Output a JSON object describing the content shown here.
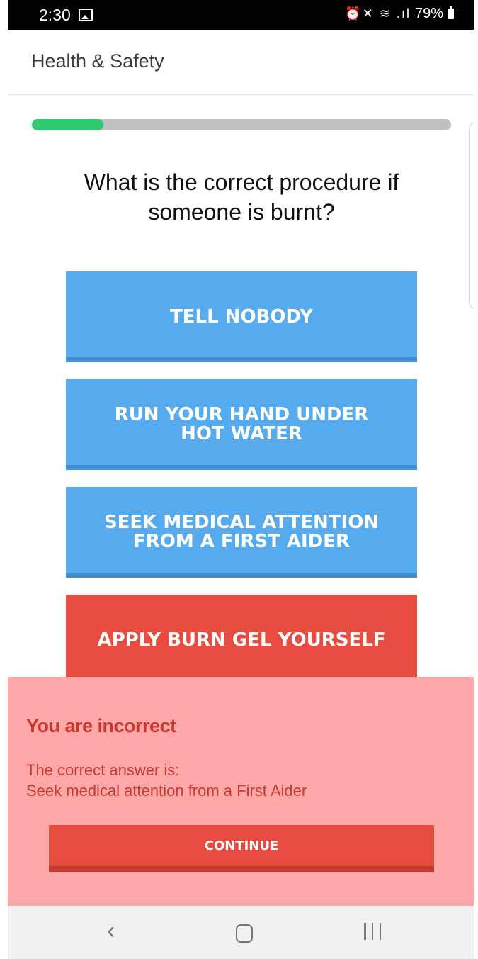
{
  "status_bar": {
    "time": "2:30",
    "battery": "79%",
    "icons": [
      "gallery-icon",
      "alarm-icon",
      "mute-icon",
      "wifi-icon",
      "signal-icon",
      "battery-icon"
    ]
  },
  "app_bar": {
    "title": "Health & Safety"
  },
  "quiz": {
    "progress": 0.17,
    "question": "What is the correct procedure if someone is burnt?",
    "answers": [
      {
        "label": "TELL NOBODY",
        "state": "default"
      },
      {
        "label": "RUN YOUR HAND UNDER HOT WATER",
        "state": "default"
      },
      {
        "label": "SEEK MEDICAL ATTENTION FROM A FIRST AIDER",
        "state": "default"
      },
      {
        "label": "APPLY BURN GEL YOURSELF",
        "state": "selected-incorrect"
      }
    ]
  },
  "feedback": {
    "title": "You are incorrect",
    "line1": "The correct answer is:",
    "line2": "Seek medical attention from a First Aider",
    "button_label": "CONTINUE"
  },
  "colors": {
    "progress": "#2ecb70",
    "answer_default": "#56aaee",
    "answer_incorrect": "#e64c3f",
    "feedback_bg": "#fea8aa",
    "feedback_text": "#c8392f"
  },
  "nav_bar": {
    "icons": [
      "back-icon",
      "home-icon",
      "recent-apps-icon"
    ]
  }
}
